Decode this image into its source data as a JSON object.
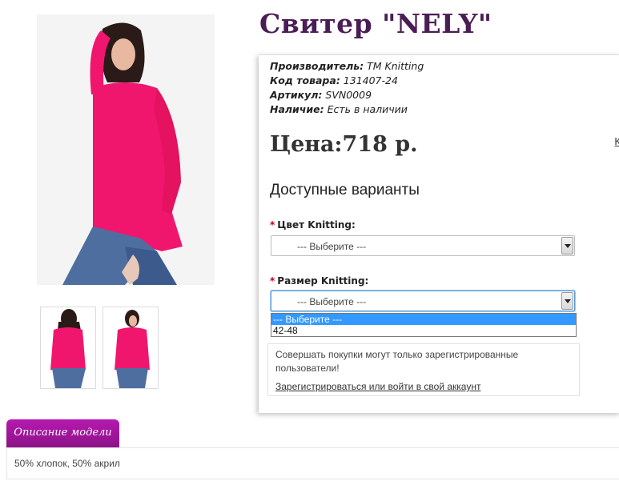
{
  "product": {
    "title": "Свитер \"NELY\"",
    "price": "Цена:718 р.",
    "right_edge_text": "К"
  },
  "meta": {
    "manufacturer_label": "Производитель:",
    "manufacturer_value": " ТМ Knitting",
    "code_label": "Код товара:",
    "code_value": " 131407-24",
    "sku_label": "Артикул:",
    "sku_value": " SVN0009",
    "stock_label": "Наличие:",
    "stock_value": " Есть в наличии"
  },
  "options": {
    "title": "Доступные варианты",
    "color_label": "Цвет Knitting:",
    "color_value": "--- Выберите ---",
    "size_label": "Размер Knitting:",
    "size_value": "--- Выберите ---",
    "size_dropdown": [
      "--- Выберите ---",
      "42-48"
    ],
    "required_mark": "*"
  },
  "notice": {
    "text": "Совершать покупки могут только зарегистрированные пользователи!",
    "link": "Зарегистрироваться или войти в свой аккаунт"
  },
  "tabs": {
    "description_label": "Описание модели",
    "description_text": "50% хлопок, 50% акрил"
  },
  "colors": {
    "title": "#4a1d55",
    "tab": "#a316a0",
    "sweater": "#f0166e",
    "highlight": "#3399ff"
  },
  "icons": [
    "chevron-down-icon"
  ]
}
